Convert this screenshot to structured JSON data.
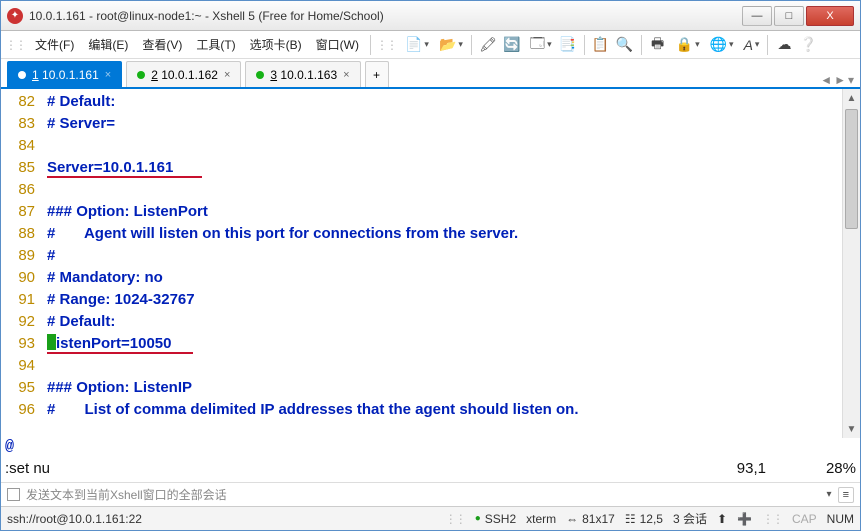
{
  "window": {
    "title": "10.0.1.161 - root@linux-node1:~ - Xshell 5 (Free for Home/School)",
    "min": "—",
    "max": "□",
    "close": "X"
  },
  "menus": {
    "file": "文件(F)",
    "edit": "编辑(E)",
    "view": "查看(V)",
    "tools": "工具(T)",
    "options": "选项卡(B)",
    "window": "窗口(W)"
  },
  "tabs": {
    "t1_prefix": "1",
    "t1_label": " 10.0.1.161",
    "t2_prefix": "2",
    "t2_label": " 10.0.1.162",
    "t3_prefix": "3",
    "t3_label": " 10.0.1.163",
    "add": "+",
    "x": "×",
    "nav_l": "◄",
    "nav_r": "►",
    "nav_d": "▾"
  },
  "lines": {
    "n82": "82",
    "n83": "83",
    "n84": "84",
    "n85": "85",
    "n86": "86",
    "n87": "87",
    "n88": "88",
    "n89": "89",
    "n90": "90",
    "n91": "91",
    "n92": "92",
    "n93": "93",
    "n94": "94",
    "n95": "95",
    "n96": "96",
    "l82": "# Default:",
    "l83": "# Server=",
    "l84": "",
    "l85": "Server=10.0.1.161",
    "l86": "",
    "l87": "### Option: ListenPort",
    "l88": "#       Agent will listen on this port for connections from the server.",
    "l89": "#",
    "l90": "# Mandatory: no",
    "l91": "# Range: 1024-32767",
    "l92": "# Default:",
    "l93_tail": "istenPort=10050",
    "l94": "",
    "l95": "### Option: ListenIP",
    "l96": "#       List of comma delimited IP addresses that the agent should listen on."
  },
  "vim": {
    "at": "@",
    "cmd": ":set nu",
    "pos": "93,1",
    "pct": "28%"
  },
  "send": {
    "label": "发送文本到当前Xshell窗口的全部会话",
    "dd": "▾",
    "menu": "≡"
  },
  "status": {
    "conn": "ssh://root@10.0.1.161:22",
    "proto": "SSH2",
    "term": "xterm",
    "size_ico": "⇔",
    "size": "81x17",
    "enc_ico": "☷",
    "enc": "12,5",
    "sess": "3 会话",
    "btn_l": "⬆",
    "btn_r": "➕",
    "cap": "CAP",
    "num": "NUM"
  }
}
